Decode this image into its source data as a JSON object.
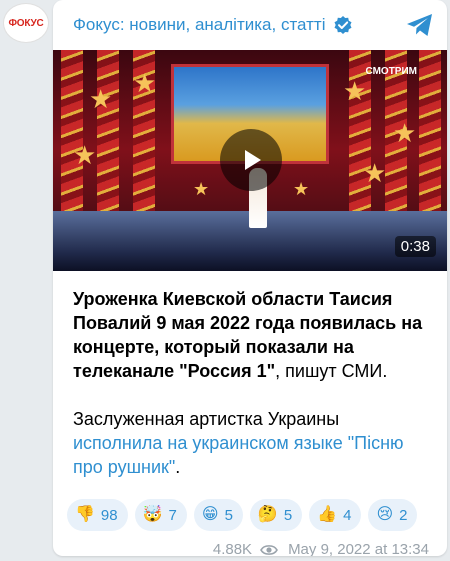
{
  "avatar": {
    "label": "ФОКУС"
  },
  "channel": {
    "title": "Фокус: новини, аналітика, статті"
  },
  "video": {
    "duration": "0:38",
    "channel_logo": "СМОТРИМ"
  },
  "post": {
    "headline_bold_1": "Уроженка Киевской области Таисия Повалий 9 мая 2022 года появилась на концерте, который показали на телеканале \"Россия 1\"",
    "headline_rest": ", пишут СМИ.",
    "para2_start": "Заслуженная артистка Украины ",
    "para2_link": "исполнила на украинском языке \"Пісню про рушник\"",
    "para2_end": "."
  },
  "reactions": [
    {
      "emoji": "👎",
      "icon": "thumbs-down-icon",
      "count": "98"
    },
    {
      "emoji": "🤯",
      "icon": "exploding-head-icon",
      "count": "7"
    },
    {
      "emoji": "😁",
      "icon": "grinning-face-icon",
      "count": "5"
    },
    {
      "emoji": "🤔",
      "icon": "thinking-face-icon",
      "count": "5"
    },
    {
      "emoji": "👍",
      "icon": "thumbs-up-icon",
      "count": "4"
    },
    {
      "emoji": "😢",
      "icon": "crying-face-icon",
      "count": "2"
    }
  ],
  "meta": {
    "views": "4.88K",
    "timestamp": "May 9, 2022 at 13:34"
  },
  "colors": {
    "accent": "#2f8fd0",
    "background": "#e7ebee",
    "brand_red": "#d7261e"
  }
}
